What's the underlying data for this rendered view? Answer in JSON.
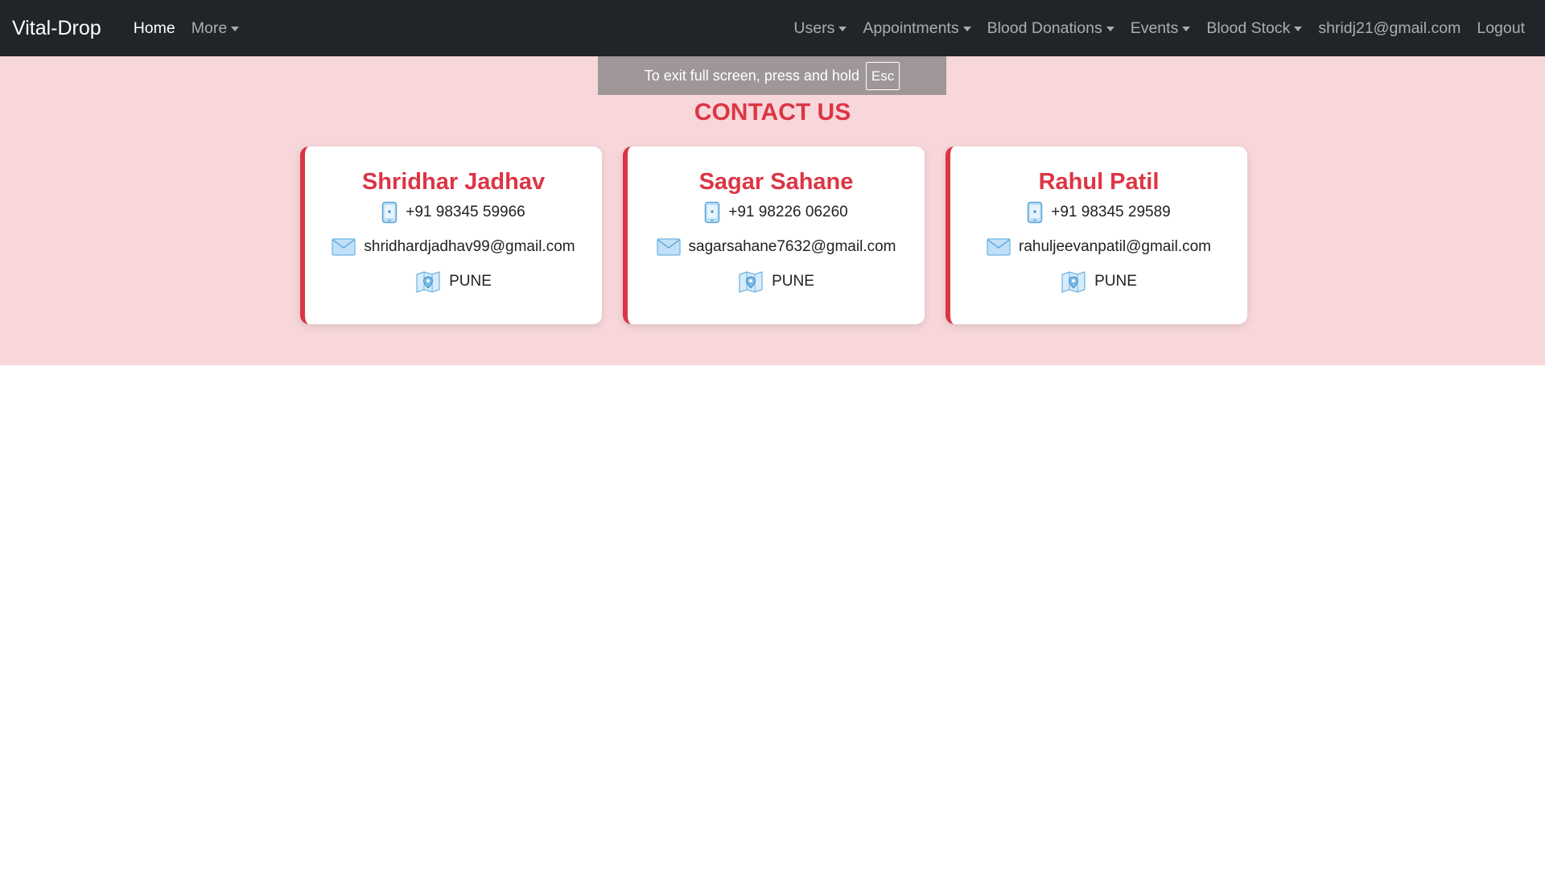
{
  "navbar": {
    "brand": "Vital-Drop",
    "home": "Home",
    "more": "More",
    "right_items": [
      "Users",
      "Appointments",
      "Blood Donations",
      "Events",
      "Blood Stock"
    ],
    "user_email": "shridj21@gmail.com",
    "logout": "Logout"
  },
  "contact": {
    "title": "CONTACT US",
    "cards": [
      {
        "name": "Shridhar Jadhav",
        "phone": "+91 98345 59966",
        "email": "shridhardjadhav99@gmail.com",
        "city": "PUNE"
      },
      {
        "name": "Sagar Sahane",
        "phone": "+91 98226 06260",
        "email": "sagarsahane7632@gmail.com",
        "city": "PUNE"
      },
      {
        "name": "Rahul Patil",
        "phone": "+91 98345 29589",
        "email": "rahuljeevanpatil@gmail.com",
        "city": "PUNE"
      }
    ]
  },
  "fullscreen_toast": {
    "text": "To exit full screen, press and hold",
    "key": "Esc"
  },
  "colors": {
    "navbar_bg": "#212529",
    "accent": "#dc3545",
    "section_bg": "#f8d7da"
  },
  "icons": [
    "phone-icon",
    "envelope-icon",
    "map-pin-icon",
    "caret-down-icon"
  ]
}
